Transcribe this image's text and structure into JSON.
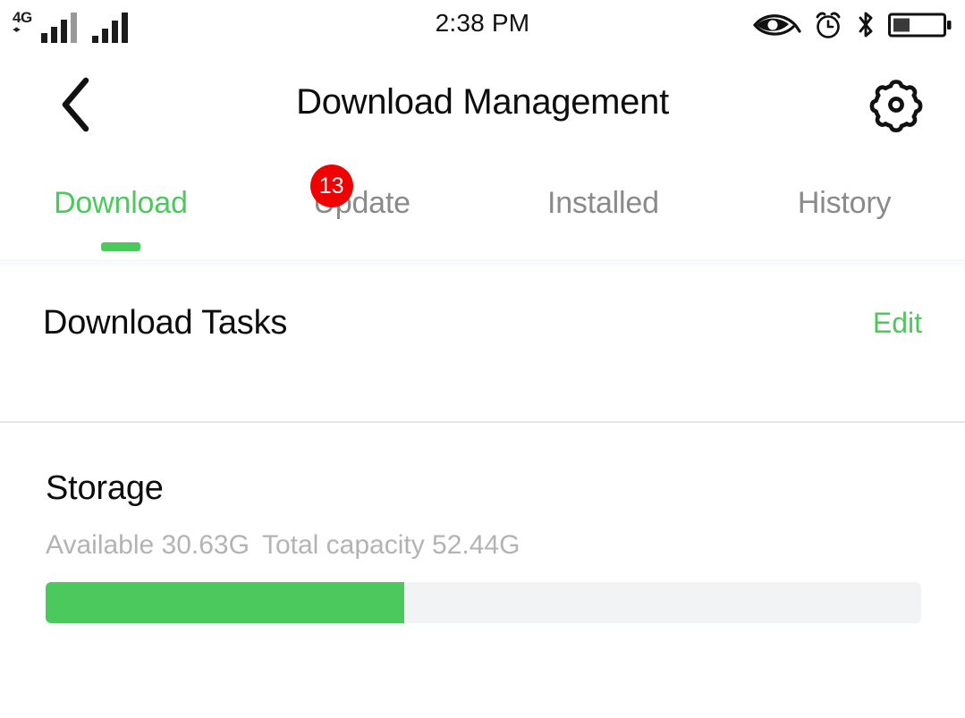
{
  "status_bar": {
    "network_label": "4G",
    "time": "2:38 PM",
    "icons": [
      "eye-icon",
      "alarm-clock-icon",
      "bluetooth-icon",
      "battery-icon"
    ],
    "battery_level_pct": 33
  },
  "header": {
    "back_label": "‹",
    "title": "Download Management",
    "settings_icon": "gear-icon"
  },
  "tabs": [
    {
      "label": "Download",
      "active": true,
      "badge": null
    },
    {
      "label": "Update",
      "active": false,
      "badge": "13"
    },
    {
      "label": "Installed",
      "active": false,
      "badge": null
    },
    {
      "label": "History",
      "active": false,
      "badge": null
    }
  ],
  "tasks_section": {
    "title": "Download Tasks",
    "edit_label": "Edit"
  },
  "storage_section": {
    "title": "Storage",
    "available_text": "Available 30.63G",
    "total_text": "Total capacity 52.44G",
    "used_percent": 41
  },
  "colors": {
    "accent_green": "#4CC95C",
    "badge_red": "#F00000",
    "muted_gray": "#8a8a8a",
    "stats_gray": "#b3b3b3",
    "divider": "#e3e5e7",
    "track": "#f2f3f4"
  }
}
